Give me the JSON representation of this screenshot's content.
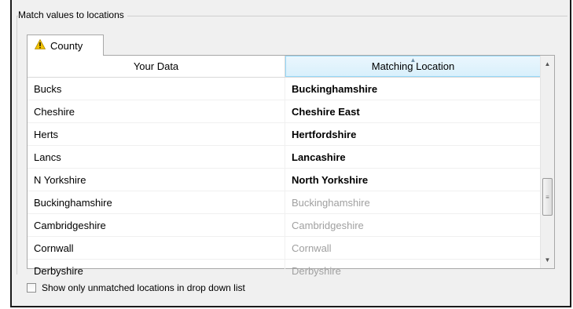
{
  "group": {
    "title": "Match values to locations"
  },
  "tab": {
    "label": "County",
    "icon": "warning-icon"
  },
  "table": {
    "columns": [
      "Your Data",
      "Matching Location"
    ],
    "rows": [
      {
        "data": "Bucks",
        "match": "Buckinghamshire",
        "status": "matched"
      },
      {
        "data": "Cheshire",
        "match": "Cheshire East",
        "status": "matched"
      },
      {
        "data": "Herts",
        "match": "Hertfordshire",
        "status": "matched"
      },
      {
        "data": "Lancs",
        "match": "Lancashire",
        "status": "matched"
      },
      {
        "data": "N Yorkshire",
        "match": "North Yorkshire",
        "status": "matched"
      },
      {
        "data": "Buckinghamshire",
        "match": "Buckinghamshire",
        "status": "unmatched"
      },
      {
        "data": "Cambridgeshire",
        "match": "Cambridgeshire",
        "status": "unmatched"
      },
      {
        "data": "Cornwall",
        "match": "Cornwall",
        "status": "unmatched"
      },
      {
        "data": "Derbyshire",
        "match": "Derbyshire",
        "status": "unmatched"
      }
    ]
  },
  "checkbox": {
    "label": "Show only unmatched locations in drop down list",
    "checked": false
  },
  "colors": {
    "warning": "#f2c200",
    "header_highlight": "#d9f0fc",
    "unmatched_text": "#a0a0a0"
  }
}
